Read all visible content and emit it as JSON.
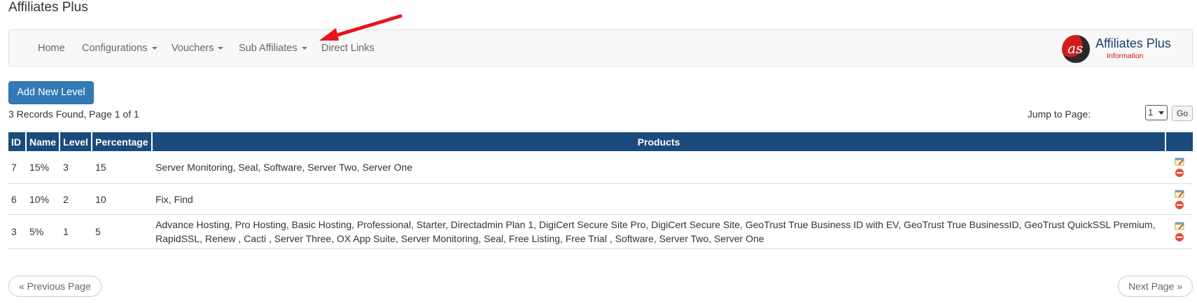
{
  "page": {
    "title": "Affiliates Plus"
  },
  "nav": {
    "items": [
      {
        "label": "Home",
        "dropdown": false
      },
      {
        "label": "Configurations",
        "dropdown": true
      },
      {
        "label": "Vouchers",
        "dropdown": true
      },
      {
        "label": "Sub Affiliates",
        "dropdown": true
      },
      {
        "label": "Direct Links",
        "dropdown": false
      }
    ],
    "brand": {
      "name": "Affiliates Plus",
      "sub": "Information",
      "logo_text": "as"
    }
  },
  "toolbar": {
    "add_label": "Add New Level"
  },
  "records": {
    "summary": "3 Records Found, Page 1 of 1"
  },
  "jump": {
    "label": "Jump to Page:",
    "selected": "1",
    "go_label": "Go"
  },
  "table": {
    "headers": [
      "ID",
      "Name",
      "Level",
      "Percentage",
      "Products",
      ""
    ],
    "rows": [
      {
        "id": "7",
        "name": "15%",
        "level": "3",
        "percentage": "15",
        "products": "Server Monitoring, Seal, Software, Server Two, Server One"
      },
      {
        "id": "6",
        "name": "10%",
        "level": "2",
        "percentage": "10",
        "products": "Fix, Find"
      },
      {
        "id": "3",
        "name": "5%",
        "level": "1",
        "percentage": "5",
        "products": "Advance Hosting, Pro Hosting, Basic Hosting, Professional, Starter, Directadmin Plan 1, DigiCert Secure Site Pro, DigiCert Secure Site, GeoTrust True Business ID with EV, GeoTrust True BusinessID, GeoTrust QuickSSL Premium, RapidSSL, Renew , Cacti , Server Three, OX App Suite, Server Monitoring, Seal, Free Listing, Free Trial , Software, Server Two, Server One"
      }
    ]
  },
  "pagination": {
    "prev_label": "« Previous Page",
    "next_label": "Next Page »"
  },
  "colors": {
    "header_bg": "#1b4b7d",
    "primary": "#337ab7",
    "annotation_arrow": "#e8141c"
  }
}
